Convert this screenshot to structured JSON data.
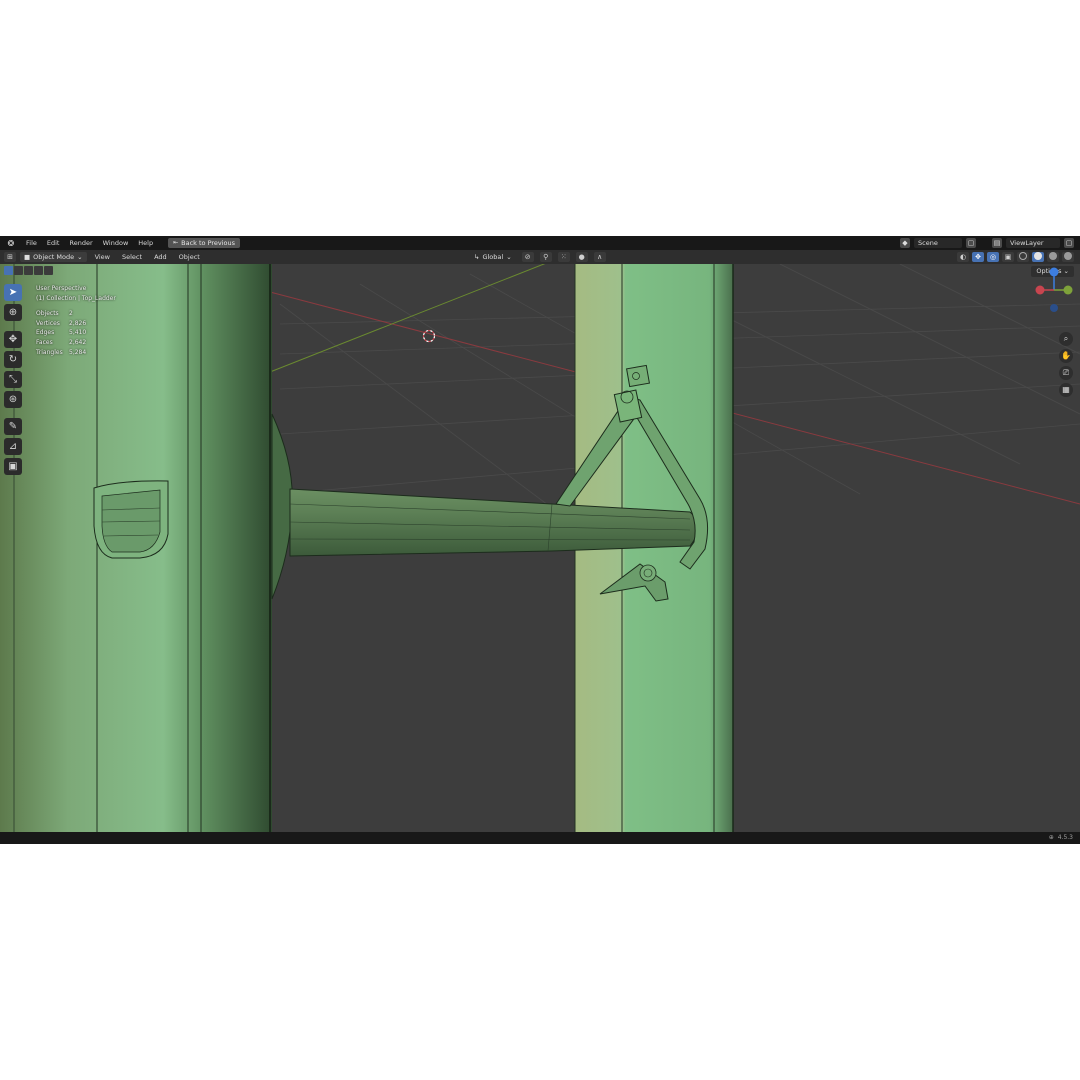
{
  "menubar": {
    "items": [
      "File",
      "Edit",
      "Render",
      "Window",
      "Help"
    ],
    "back_button": "Back to Previous",
    "scene": "Scene",
    "view_layer": "ViewLayer"
  },
  "header": {
    "mode": "Object Mode",
    "menus": [
      "View",
      "Select",
      "Add",
      "Object"
    ],
    "orientation": "Global",
    "options": "Options"
  },
  "overlay": {
    "perspective": "User Perspective",
    "collection": "(1) Collection | Top_Ladder",
    "stats": [
      {
        "label": "Objects",
        "value": "2"
      },
      {
        "label": "Vertices",
        "value": "2,826"
      },
      {
        "label": "Edges",
        "value": "5,410"
      },
      {
        "label": "Faces",
        "value": "2,642"
      },
      {
        "label": "Triangles",
        "value": "5,284"
      }
    ]
  },
  "gizmo": {
    "x_color": "#c8454f",
    "y_color": "#7ea23a",
    "z_color": "#3d7ee0"
  },
  "status": {
    "version": "4.5.3"
  },
  "colors": {
    "model_green": "#7bb47f",
    "model_dark": "#3e5c3e",
    "active_blue": "#4772b3"
  },
  "icons": [
    "blender-logo-icon",
    "select-box-icon",
    "cursor-icon",
    "move-icon",
    "rotate-icon",
    "scale-icon",
    "transform-icon",
    "annotate-icon",
    "measure-icon",
    "add-cube-icon",
    "zoom-icon",
    "hand-icon",
    "camera-icon",
    "grid-icon"
  ]
}
